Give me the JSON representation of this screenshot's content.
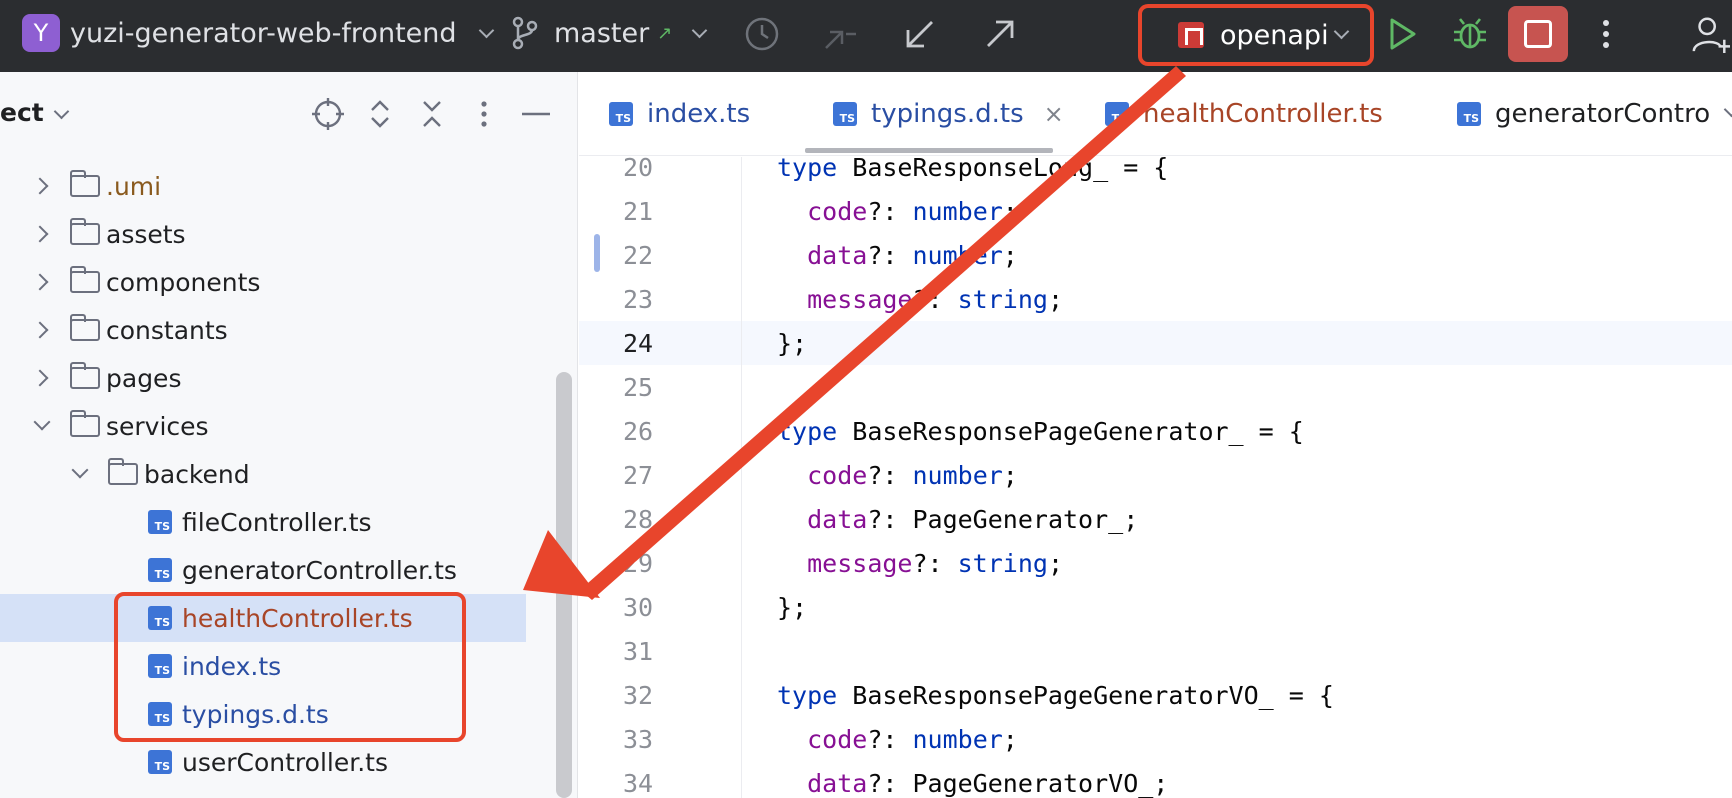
{
  "toolbar": {
    "project_initial": "Y",
    "project_name": "yuzi-generator-web-frontend",
    "branch": "master",
    "branch_status_arrow": "↗",
    "run_config": "openapi",
    "icons": [
      "history-icon",
      "fetch-icon",
      "update-icon",
      "push-icon",
      "run-icon",
      "debug-icon",
      "stop-icon",
      "more-icon",
      "add-user-icon"
    ]
  },
  "project_panel": {
    "title": "ect",
    "tree": [
      {
        "label": ".umi",
        "type": "folder",
        "state": "collapsed"
      },
      {
        "label": "assets",
        "type": "folder",
        "state": "collapsed"
      },
      {
        "label": "components",
        "type": "folder",
        "state": "collapsed"
      },
      {
        "label": "constants",
        "type": "folder",
        "state": "collapsed"
      },
      {
        "label": "pages",
        "type": "folder",
        "state": "collapsed"
      },
      {
        "label": "services",
        "type": "folder",
        "state": "expanded"
      },
      {
        "label": "backend",
        "type": "folder",
        "state": "expanded"
      },
      {
        "label": "fileController.ts",
        "type": "ts"
      },
      {
        "label": "generatorController.ts",
        "type": "ts"
      },
      {
        "label": "healthController.ts",
        "type": "ts",
        "selected": true
      },
      {
        "label": "index.ts",
        "type": "ts"
      },
      {
        "label": "typings.d.ts",
        "type": "ts"
      },
      {
        "label": "userController.ts",
        "type": "ts"
      }
    ]
  },
  "tabs": [
    {
      "label": "index.ts",
      "icon": "TS"
    },
    {
      "label": "typings.d.ts",
      "icon": "TS",
      "active": true,
      "close": "×"
    },
    {
      "label": "healthController.ts",
      "icon": "TS"
    },
    {
      "label": "generatorContro",
      "icon": "TS"
    }
  ],
  "code": [
    {
      "ln": "20",
      "parts": [
        [
          "kw",
          "type"
        ],
        [
          "",
          " BaseResponseLong_ = {"
        ]
      ]
    },
    {
      "ln": "21",
      "parts": [
        [
          "",
          "  "
        ],
        [
          "prop",
          "code"
        ],
        [
          "",
          "?: "
        ],
        [
          "kw",
          "number"
        ],
        [
          "",
          ";"
        ]
      ]
    },
    {
      "ln": "22",
      "parts": [
        [
          "",
          "  "
        ],
        [
          "prop",
          "data"
        ],
        [
          "",
          "?: "
        ],
        [
          "kw",
          "number"
        ],
        [
          "",
          ";"
        ]
      ]
    },
    {
      "ln": "23",
      "parts": [
        [
          "",
          "  "
        ],
        [
          "prop",
          "message"
        ],
        [
          "",
          "?: "
        ],
        [
          "kw",
          "string"
        ],
        [
          "",
          ";"
        ]
      ]
    },
    {
      "ln": "24",
      "parts": [
        [
          "",
          "};"
        ]
      ],
      "current": true
    },
    {
      "ln": "25",
      "parts": []
    },
    {
      "ln": "26",
      "parts": [
        [
          "kw",
          "type"
        ],
        [
          "",
          " BaseResponsePageGenerator_ = {"
        ]
      ]
    },
    {
      "ln": "27",
      "parts": [
        [
          "",
          "  "
        ],
        [
          "prop",
          "code"
        ],
        [
          "",
          "?: "
        ],
        [
          "kw",
          "number"
        ],
        [
          "",
          ";"
        ]
      ]
    },
    {
      "ln": "28",
      "parts": [
        [
          "",
          "  "
        ],
        [
          "prop",
          "data"
        ],
        [
          "",
          "?: PageGenerator_;"
        ]
      ]
    },
    {
      "ln": "29",
      "parts": [
        [
          "",
          "  "
        ],
        [
          "prop",
          "message"
        ],
        [
          "",
          "?: "
        ],
        [
          "kw",
          "string"
        ],
        [
          "",
          ";"
        ]
      ]
    },
    {
      "ln": "30",
      "parts": [
        [
          "",
          "};"
        ]
      ]
    },
    {
      "ln": "31",
      "parts": []
    },
    {
      "ln": "32",
      "parts": [
        [
          "kw",
          "type"
        ],
        [
          "",
          " BaseResponsePageGeneratorVO_ = {"
        ]
      ]
    },
    {
      "ln": "33",
      "parts": [
        [
          "",
          "  "
        ],
        [
          "prop",
          "code"
        ],
        [
          "",
          "?: "
        ],
        [
          "kw",
          "number"
        ],
        [
          "",
          ";"
        ]
      ]
    },
    {
      "ln": "34",
      "parts": [
        [
          "",
          "  "
        ],
        [
          "prop",
          "data"
        ],
        [
          "",
          "?: PageGeneratorVO_;"
        ]
      ]
    }
  ],
  "colors": {
    "toolbar_bg": "#2b2d30",
    "annotation_red": "#e8452c",
    "selection": "#d5e1f7",
    "keyword": "#0033b3",
    "property": "#871094"
  }
}
